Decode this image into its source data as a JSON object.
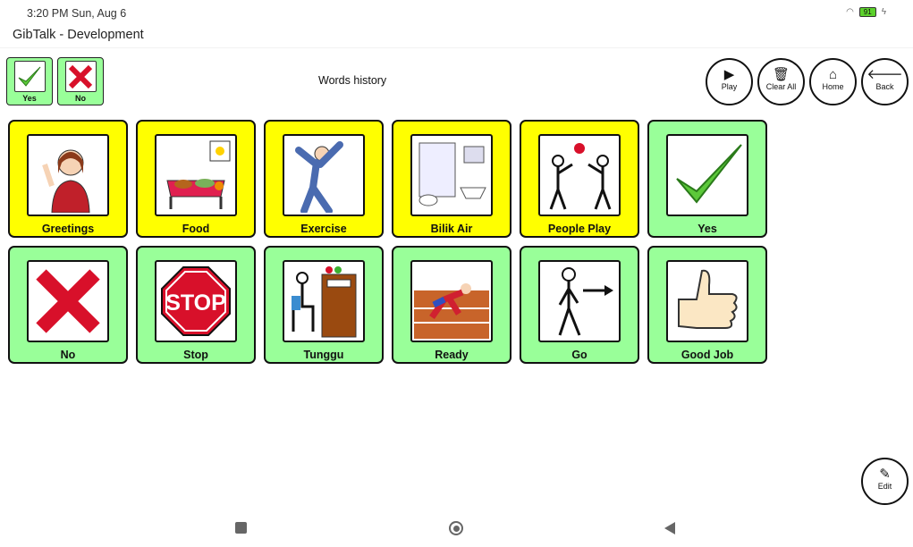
{
  "status": {
    "time": "3:20 PM Sun, Aug 6",
    "battery": "91"
  },
  "app": {
    "title": "GibTalk - Development"
  },
  "quick": [
    {
      "label": "Yes"
    },
    {
      "label": "No"
    }
  ],
  "history_label": "Words history",
  "controls": [
    {
      "label": "Play",
      "icon": "play-icon"
    },
    {
      "label": "Clear All",
      "icon": "trash-icon"
    },
    {
      "label": "Home",
      "icon": "home-icon"
    },
    {
      "label": "Back",
      "icon": "arrow-left-icon"
    }
  ],
  "tiles": [
    {
      "label": "Greetings",
      "color": "#ffff00"
    },
    {
      "label": "Food",
      "color": "#ffff00"
    },
    {
      "label": "Exercise",
      "color": "#ffff00"
    },
    {
      "label": "Bilik Air",
      "color": "#ffff00"
    },
    {
      "label": "People Play",
      "color": "#ffff00"
    },
    {
      "label": "Yes",
      "color": "#99ff99"
    },
    {
      "label": "No",
      "color": "#99ff99"
    },
    {
      "label": "Stop",
      "color": "#99ff99"
    },
    {
      "label": "Tunggu",
      "color": "#99ff99"
    },
    {
      "label": "Ready",
      "color": "#99ff99"
    },
    {
      "label": "Go",
      "color": "#99ff99"
    },
    {
      "label": "Good Job",
      "color": "#99ff99"
    }
  ],
  "stop_sign": "STOP",
  "edit": {
    "label": "Edit"
  }
}
